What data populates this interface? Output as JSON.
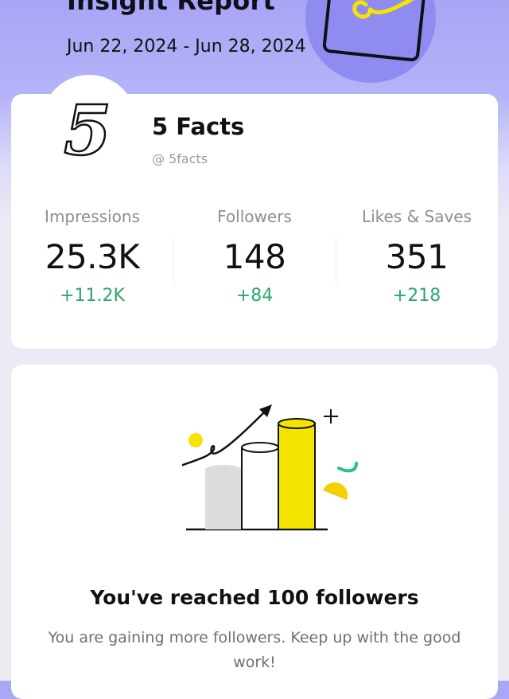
{
  "header": {
    "title": "Insight Report",
    "date_range": "Jun 22, 2024 - Jun 28, 2024"
  },
  "profile": {
    "avatar_glyph": "5",
    "name": "5 Facts",
    "handle": "@ 5facts"
  },
  "stats": [
    {
      "label": "Impressions",
      "value": "25.3K",
      "change": "+11.2K"
    },
    {
      "label": "Followers",
      "value": "148",
      "change": "+84"
    },
    {
      "label": "Likes & Saves",
      "value": "351",
      "change": "+218"
    }
  ],
  "milestone": {
    "title": "You've reached 100 followers",
    "description": "You are gaining more followers. Keep up with the good work!"
  },
  "colors": {
    "header_bg": "#a8a5f6",
    "accent_yellow": "#f5e400",
    "positive_green": "#2ba86b",
    "card_bg": "#ffffff"
  },
  "icons": [
    "notebook-pen-illustration",
    "avatar-five-logo",
    "growth-chart-illustration"
  ]
}
